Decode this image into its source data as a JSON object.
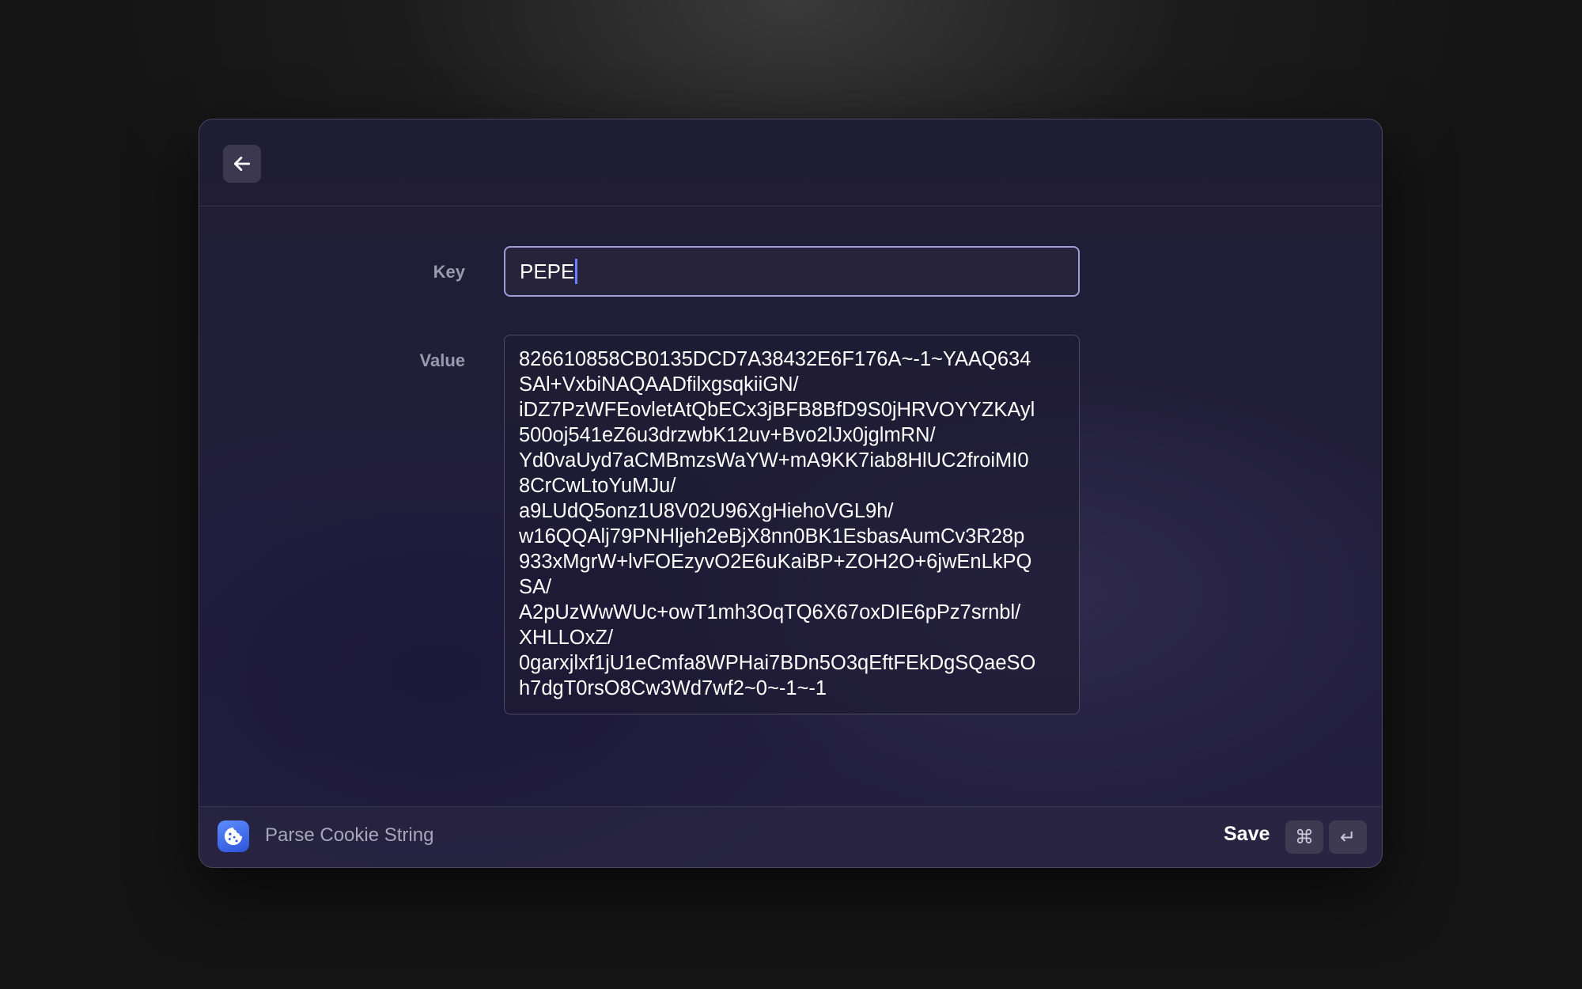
{
  "form": {
    "key_label": "Key",
    "key_value": "PEPE",
    "value_label": "Value",
    "value_lines": [
      "826610858CB0135DCD7A38432E6F176A~-1~YAAQ634",
      "SAl+VxbiNAQAADfilxgsqkiiGN/",
      "iDZ7PzWFEovletAtQbECx3jBFB8BfD9S0jHRVOYYZKAyl",
      "500oj541eZ6u3drzwbK12uv+Bvo2lJx0jglmRN/",
      "Yd0vaUyd7aCMBmzsWaYW+mA9KK7iab8HlUC2froiMI0",
      "8CrCwLtoYuMJu/",
      "a9LUdQ5onz1U8V02U96XgHiehoVGL9h/",
      "w16QQAlj79PNHljeh2eBjX8nn0BK1EsbasAumCv3R28p",
      "933xMgrW+lvFOEzyvO2E6uKaiBP+ZOH2O+6jwEnLkPQ",
      "SA/",
      "A2pUzWwWUc+owT1mh3OqTQ6X67oxDIE6pPz7srnbl/",
      "XHLLOxZ/",
      "0garxjlxf1jU1eCmfa8WPHai7BDn5O3qEftFEkDgSQaeSO",
      "h7dgT0rsO8Cw3Wd7wf2~0~-1~-1"
    ]
  },
  "footer": {
    "extension_title": "Parse Cookie String",
    "save_label": "Save",
    "shortcut_cmd": "⌘",
    "shortcut_enter": "↵"
  },
  "icons": {
    "back": "arrow-left-icon",
    "extension": "cookie-icon"
  },
  "colors": {
    "accent_border": "#a29bd8",
    "caret": "#6f7dff",
    "extension_icon": "#3b6cf0"
  }
}
